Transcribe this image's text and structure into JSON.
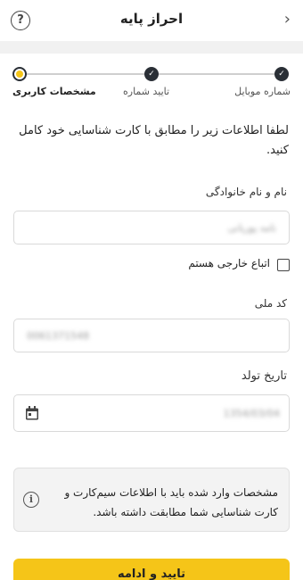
{
  "header": {
    "title": "احراز پایه",
    "help_icon": "help-circle-icon",
    "back_icon": "chevron-right-icon"
  },
  "stepper": {
    "steps": [
      {
        "label": "شماره موبایل",
        "state": "done"
      },
      {
        "label": "تایید شماره",
        "state": "done"
      },
      {
        "label": "مشخصات کاربری",
        "state": "active"
      }
    ]
  },
  "form": {
    "intro": "لطفا اطلاعات زیر را مطابق با کارت شناسایی خود کامل کنید.",
    "fullname_label": "نام و نام خانوادگی",
    "fullname_value": "نامه پوریانی",
    "foreign_label": "اتباع خارجی هستم",
    "national_code_label": "کد ملی",
    "national_code_value": "0061371548",
    "birthdate_label": "تاریخ تولد",
    "birthdate_value": "1354/03/04"
  },
  "note": {
    "text": "مشخصات وارد شده باید با اطلاعات سیم‌کارت و کارت شناسایی شما مطابقت داشته باشد."
  },
  "actions": {
    "submit_label": "تایید و ادامه"
  },
  "colors": {
    "accent": "#f5c518",
    "step_done": "#2a2f36"
  }
}
